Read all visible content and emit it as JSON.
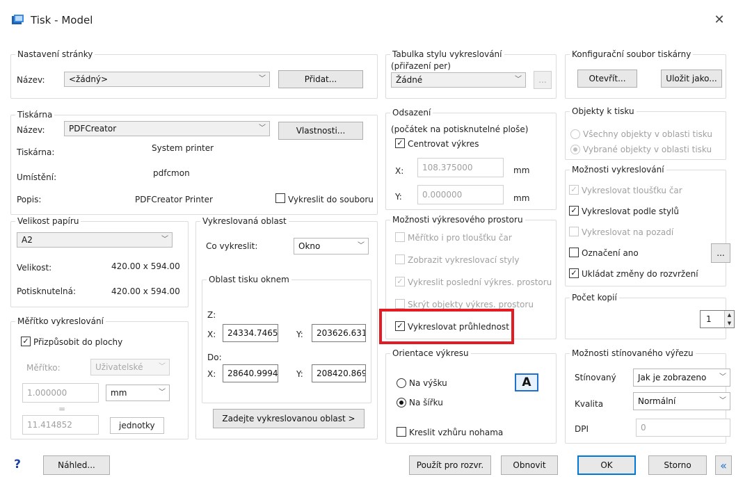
{
  "window": {
    "title": "Tisk -  Model"
  },
  "page_setup": {
    "title": "Nastavení stránky",
    "name_label": "Název:",
    "name_value": "<žádný>",
    "add_button": "Přidat..."
  },
  "printer": {
    "title": "Tiskárna",
    "name_label": "Název:",
    "name_value": "PDFCreator",
    "properties_button": "Vlastnosti...",
    "printer_label": "Tiskárna:",
    "printer_value": "System printer",
    "location_label": "Umístění:",
    "location_value": "pdfcmon",
    "description_label": "Popis:",
    "description_value": "PDFCreator Printer",
    "print_to_file": "Vykreslit do souboru"
  },
  "paper_size": {
    "title": "Velikost papíru",
    "value": "A2",
    "size_label": "Velikost:",
    "size_value": "420.00 x 594.00",
    "printable_label": "Potisknutelná:",
    "printable_value": "420.00 x 594.00"
  },
  "plot_scale": {
    "title": "Měřítko vykreslování",
    "fit_to_paper": "Přizpůsobit do plochy",
    "scale_label": "Měřítko:",
    "scale_value": "Uživatelské",
    "value1": "1.000000",
    "unit": "mm",
    "equals": "=",
    "value2": "11.414852",
    "units_label": "jednotky"
  },
  "plot_area": {
    "title": "Vykreslovaná oblast",
    "what_label": "Co vykreslit:",
    "what_value": "Okno",
    "window_group_title": "Oblast tisku oknem",
    "from_label": "Z:",
    "x_label": "X:",
    "y_label": "Y:",
    "from_x": "24334.7465",
    "from_y": "203626.631",
    "to_label": "Do:",
    "to_x": "28640.9994",
    "to_y": "208420.869",
    "enter_area_button": "Zadejte vykreslovanou oblast >"
  },
  "plot_style_table": {
    "title": "Tabulka stylu vykreslování",
    "subtitle": "(přiřazení per)",
    "value": "Žádné",
    "edit_button": "..."
  },
  "plot_offset": {
    "title": "Odsazení",
    "subtitle": "(počátek na potisknutelné ploše)",
    "center": "Centrovat výkres",
    "x_label": "X:",
    "x_value": "108.375000",
    "x_unit": "mm",
    "y_label": "Y:",
    "y_value": "0.000000",
    "y_unit": "mm"
  },
  "paperspace_options": {
    "title": "Možnosti výkresového prostoru",
    "scale_lineweights": "Měřítko i pro tloušťku čar",
    "display_styles": "Zobrazit vykreslovací styly",
    "plot_paperspace_last": "Vykreslit poslední výkres. prostoru",
    "hide_objects": "Skrýt objekty výkres. prostoru",
    "plot_transparency": "Vykreslovat průhlednost"
  },
  "orientation": {
    "title": "Orientace výkresu",
    "portrait": "Na výšku",
    "landscape": "Na šířku",
    "upside_down": "Kreslit vzhůru nohama",
    "icon_letter": "A"
  },
  "printer_config": {
    "title": "Konfigurační soubor tiskárny",
    "open_button": "Otevřít...",
    "save_as_button": "Uložit jako..."
  },
  "objects_to_print": {
    "title": "Objekty k tisku",
    "all": "Všechny objekty v oblasti tisku",
    "selected": "Vybrané objekty v oblasti tisku"
  },
  "plot_options": {
    "title": "Možnosti vykreslování",
    "lineweights": "Vykreslovat tloušťku čar",
    "by_styles": "Vykreslovat podle stylů",
    "background": "Vykreslovat na pozadí",
    "stamp": "Označení ano",
    "stamp_button": "...",
    "save_changes": "Ukládat změny do rozvržení"
  },
  "copies": {
    "title": "Počet kopií",
    "value": "1"
  },
  "shaded_viewport": {
    "title": "Možnosti stínovaného výřezu",
    "shade_label": "Stínovaný",
    "shade_value": "Jak je zobrazeno",
    "quality_label": "Kvalita",
    "quality_value": "Normální",
    "dpi_label": "DPI",
    "dpi_value": "0"
  },
  "footer": {
    "help_icon": "?",
    "preview_button": "Náhled...",
    "apply_layout_button": "Použít pro rozvr.",
    "refresh_button": "Obnovit",
    "ok_button": "OK",
    "cancel_button": "Storno",
    "collapse_button": "«"
  }
}
